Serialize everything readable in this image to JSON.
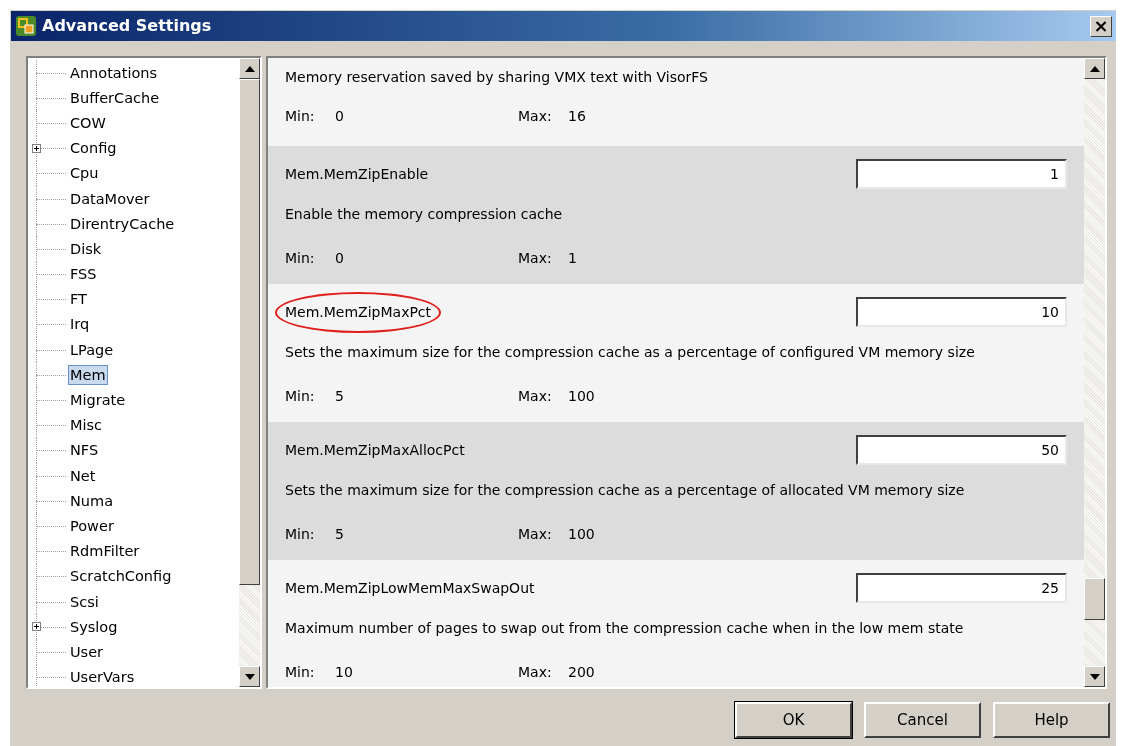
{
  "window": {
    "title": "Advanced Settings",
    "close": "×"
  },
  "tree": {
    "items": [
      {
        "label": "Annotations",
        "expandable": false,
        "selected": false
      },
      {
        "label": "BufferCache",
        "expandable": false,
        "selected": false
      },
      {
        "label": "COW",
        "expandable": false,
        "selected": false
      },
      {
        "label": "Config",
        "expandable": true,
        "selected": false
      },
      {
        "label": "Cpu",
        "expandable": false,
        "selected": false
      },
      {
        "label": "DataMover",
        "expandable": false,
        "selected": false
      },
      {
        "label": "DirentryCache",
        "expandable": false,
        "selected": false
      },
      {
        "label": "Disk",
        "expandable": false,
        "selected": false
      },
      {
        "label": "FSS",
        "expandable": false,
        "selected": false
      },
      {
        "label": "FT",
        "expandable": false,
        "selected": false
      },
      {
        "label": "Irq",
        "expandable": false,
        "selected": false
      },
      {
        "label": "LPage",
        "expandable": false,
        "selected": false
      },
      {
        "label": "Mem",
        "expandable": false,
        "selected": true
      },
      {
        "label": "Migrate",
        "expandable": false,
        "selected": false
      },
      {
        "label": "Misc",
        "expandable": false,
        "selected": false
      },
      {
        "label": "NFS",
        "expandable": false,
        "selected": false
      },
      {
        "label": "Net",
        "expandable": false,
        "selected": false
      },
      {
        "label": "Numa",
        "expandable": false,
        "selected": false
      },
      {
        "label": "Power",
        "expandable": false,
        "selected": false
      },
      {
        "label": "RdmFilter",
        "expandable": false,
        "selected": false
      },
      {
        "label": "ScratchConfig",
        "expandable": false,
        "selected": false
      },
      {
        "label": "Scsi",
        "expandable": false,
        "selected": false
      },
      {
        "label": "Syslog",
        "expandable": true,
        "selected": false
      },
      {
        "label": "User",
        "expandable": false,
        "selected": false
      },
      {
        "label": "UserVars",
        "expandable": false,
        "selected": false
      }
    ]
  },
  "settings": [
    {
      "description": "Memory reservation saved by sharing VMX text with VisorFS",
      "min_label": "Min:",
      "min": "0",
      "max_label": "Max:",
      "max": "16"
    },
    {
      "name": "Mem.MemZipEnable",
      "value": "1",
      "description": "Enable the memory compression cache",
      "min_label": "Min:",
      "min": "0",
      "max_label": "Max:",
      "max": "1"
    },
    {
      "name": "Mem.MemZipMaxPct",
      "value": "10",
      "description": "Sets the maximum size for the compression cache as a percentage of configured VM memory size",
      "min_label": "Min:",
      "min": "5",
      "max_label": "Max:",
      "max": "100",
      "circled": true
    },
    {
      "name": "Mem.MemZipMaxAllocPct",
      "value": "50",
      "description": "Sets the maximum size for the compression cache as a percentage of allocated VM memory size",
      "min_label": "Min:",
      "min": "5",
      "max_label": "Max:",
      "max": "100"
    },
    {
      "name": "Mem.MemZipLowMemMaxSwapOut",
      "value": "25",
      "description": "Maximum number of pages to swap out from the compression cache when in the low mem state",
      "min_label": "Min:",
      "min": "10",
      "max_label": "Max:",
      "max": "200"
    }
  ],
  "buttons": [
    {
      "label": "OK",
      "default": true
    },
    {
      "label": "Cancel",
      "default": false
    },
    {
      "label": "Help",
      "default": false
    }
  ]
}
